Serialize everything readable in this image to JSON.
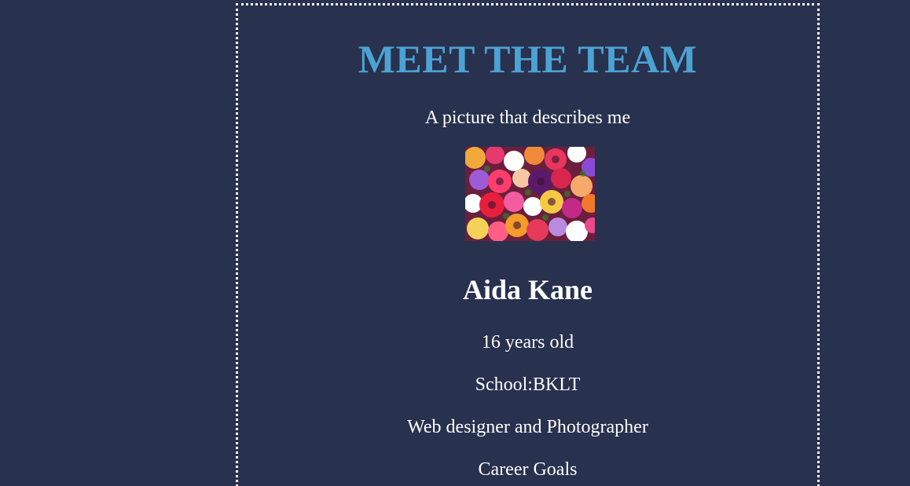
{
  "page": {
    "background": "#28314e",
    "border_color": "#ffffff"
  },
  "header": {
    "title": "MEET THE TEAM",
    "title_color": "#4ba3d3"
  },
  "profile": {
    "picture_caption": "A picture that describes me",
    "picture_icon": "flowers-photo",
    "name": "Aida Kane",
    "age": "16 years old",
    "school": "School:BKLT",
    "role": "Web designer and Photographer",
    "section_heading": "Career Goals"
  }
}
